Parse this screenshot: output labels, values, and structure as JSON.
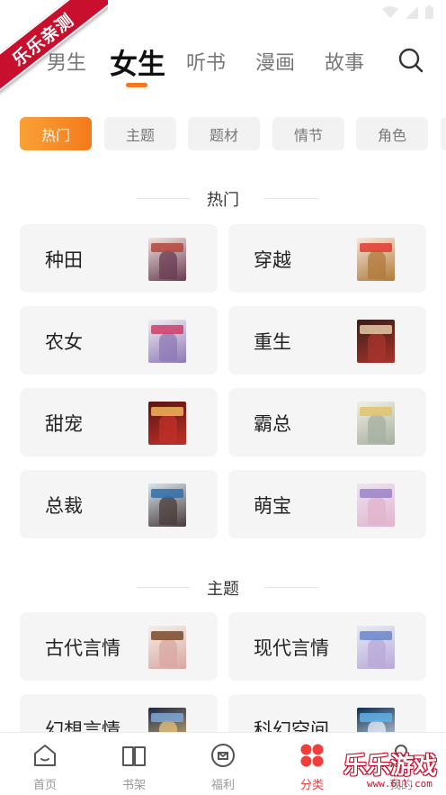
{
  "colors": {
    "accent": "#f47a1c",
    "accent_light": "#f9a136",
    "active_tab_nav": "#f23d3d",
    "card_bg": "#f5f5f5",
    "chip_bg": "#f2f2f2",
    "watermark_red": "#c8102e"
  },
  "watermark": {
    "ribbon": "乐乐亲测",
    "logo": "乐乐游戏",
    "logo_url": "www.6ll.com"
  },
  "top_nav": {
    "tabs": [
      {
        "label": "男生",
        "active": false
      },
      {
        "label": "女生",
        "active": true
      },
      {
        "label": "听书",
        "active": false
      },
      {
        "label": "漫画",
        "active": false
      },
      {
        "label": "故事",
        "active": false
      }
    ],
    "search_icon": "search-icon"
  },
  "filters": [
    {
      "label": "热门",
      "active": true
    },
    {
      "label": "主题",
      "active": false
    },
    {
      "label": "题材",
      "active": false
    },
    {
      "label": "情节",
      "active": false
    },
    {
      "label": "角色",
      "active": false
    }
  ],
  "sections": [
    {
      "title": "热门",
      "items": [
        {
          "label": "种田",
          "cover": [
            "#efe3dc",
            "#b5463a",
            "#6a3b52"
          ]
        },
        {
          "label": "穿越",
          "cover": [
            "#f6e7dc",
            "#e23b2f",
            "#b07a3a"
          ]
        },
        {
          "label": "农女",
          "cover": [
            "#f1ecf3",
            "#cc3e66",
            "#8d79b6"
          ]
        },
        {
          "label": "重生",
          "cover": [
            "#3b1b17",
            "#e6c9a4",
            "#a8342c"
          ]
        },
        {
          "label": "甜宠",
          "cover": [
            "#5a1412",
            "#f2b65a",
            "#c03028"
          ]
        },
        {
          "label": "霸总",
          "cover": [
            "#f2efe2",
            "#e2c36a",
            "#a6b0a0"
          ]
        },
        {
          "label": "总裁",
          "cover": [
            "#d7e6ef",
            "#2f6da8",
            "#4a3b3a"
          ]
        },
        {
          "label": "萌宝",
          "cover": [
            "#ece4f3",
            "#9a82c9",
            "#e2b3cc"
          ]
        }
      ]
    },
    {
      "title": "主题",
      "items": [
        {
          "label": "古代言情",
          "cover": [
            "#f4efe9",
            "#7b4a2a",
            "#d9a7a1"
          ]
        },
        {
          "label": "现代言情",
          "cover": [
            "#e7ecf6",
            "#6a86c8",
            "#b8a8d8"
          ]
        },
        {
          "label": "幻想言情",
          "cover": [
            "#1e2a44",
            "#7fa5d8",
            "#e3c27d"
          ]
        },
        {
          "label": "科幻空间",
          "cover": [
            "#0f2e55",
            "#5fb0e8",
            "#e8f0f8"
          ]
        }
      ]
    }
  ],
  "bottom_nav": [
    {
      "label": "首页",
      "icon": "home-icon",
      "active": false
    },
    {
      "label": "书架",
      "icon": "bookshelf-icon",
      "active": false
    },
    {
      "label": "福利",
      "icon": "gift-badge-icon",
      "active": false
    },
    {
      "label": "分类",
      "icon": "category-grid-icon",
      "active": true
    },
    {
      "label": "我的",
      "icon": "profile-icon",
      "active": false
    }
  ]
}
